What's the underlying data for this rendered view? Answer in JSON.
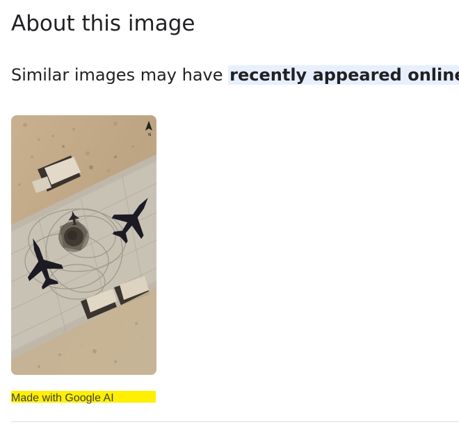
{
  "page": {
    "title": "About this image",
    "subtitle_prefix": "Similar images may have ",
    "subtitle_highlight": "recently appeared online",
    "image": {
      "alt": "Satellite image of airfield with aircraft and crater",
      "icon": "north-arrow-icon"
    },
    "ai_label": "Made with Google AI",
    "colors": {
      "highlight_blue": "#e8f0fe",
      "ai_label_yellow": "#ffef00",
      "divider": "#dadce0",
      "text": "#202124"
    }
  }
}
